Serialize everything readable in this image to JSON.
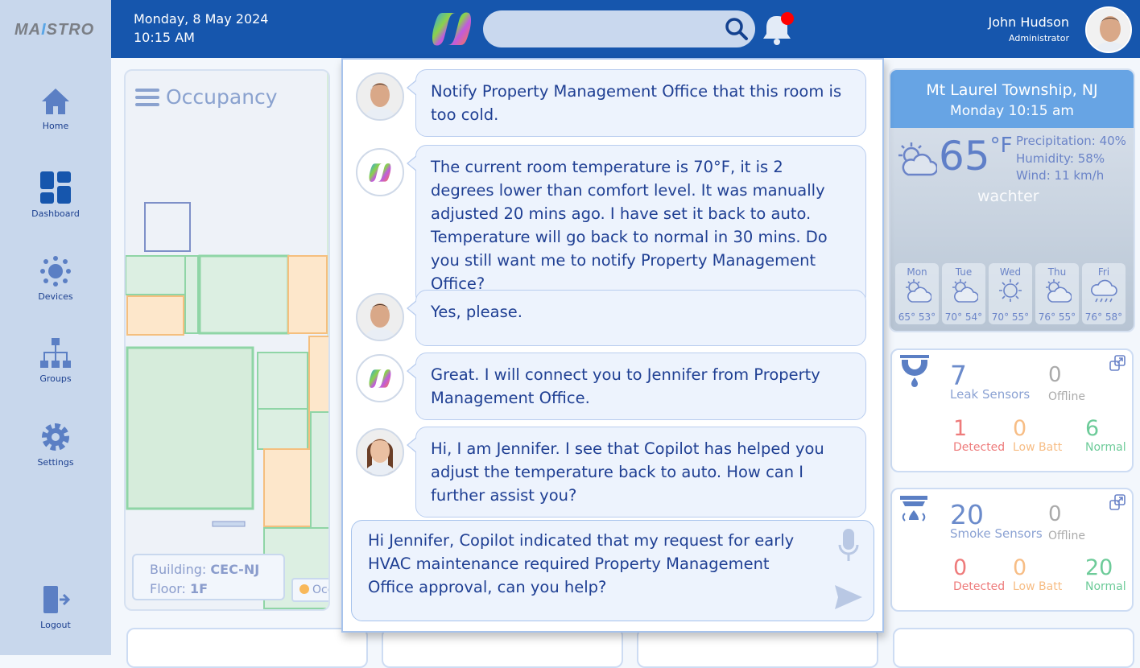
{
  "sidebar": {
    "logo": "MAISTRO",
    "items": [
      {
        "label": "Home",
        "icon": "home-icon"
      },
      {
        "label": "Dashboard",
        "icon": "dashboard-icon"
      },
      {
        "label": "Devices",
        "icon": "devices-icon"
      },
      {
        "label": "Groups",
        "icon": "groups-icon"
      },
      {
        "label": "Settings",
        "icon": "gear-icon"
      }
    ],
    "logout": "Logout"
  },
  "header": {
    "date": "Monday, 8 May 2024",
    "time": "10:15 AM",
    "search_placeholder": "",
    "user_name": "John Hudson",
    "user_role": "Administrator",
    "notification_dot_color": "#ff0000"
  },
  "occupancy": {
    "title": "Occupancy",
    "building_label": "Building:",
    "building": "CEC-NJ",
    "floor_label": "Floor:",
    "floor": "1F",
    "legend": "Occup"
  },
  "chat": {
    "messages": [
      {
        "sender": "user",
        "text": "Notify Property Management Office that this room is too cold."
      },
      {
        "sender": "copilot",
        "text": "The current room temperature is 70°F, it is 2 degrees lower than comfort level. It was manually adjusted 20 mins ago. I have set it back to auto. Temperature will go back to normal in 30 mins. Do you still want me to notify Property Management Office?"
      },
      {
        "sender": "user",
        "text": "Yes, please."
      },
      {
        "sender": "copilot",
        "text": "Great. I will connect you to Jennifer from Property Management Office."
      },
      {
        "sender": "jennifer",
        "text": "Hi, I am Jennifer. I see that Copilot has helped you adjust the temperature back to auto. How can I further assist you?"
      }
    ],
    "input_value": "Hi Jennifer, Copilot indicated that my request for early HVAC maintenance required Property Management Office approval, can you help?"
  },
  "weather": {
    "location": "Mt Laurel Township, NJ",
    "datetime": "Monday 10:15 am",
    "temp": "65",
    "unit": "°F",
    "precipitation": "Precipitation: 40%",
    "humidity": "Humidity: 58%",
    "wind": "Wind: 11 km/h",
    "brand": "wachter",
    "forecast": [
      {
        "day": "Mon",
        "hi": "65°",
        "lo": "53°",
        "icon": "partly-cloudy"
      },
      {
        "day": "Tue",
        "hi": "70°",
        "lo": "54°",
        "icon": "partly-cloudy"
      },
      {
        "day": "Wed",
        "hi": "70°",
        "lo": "55°",
        "icon": "sunny"
      },
      {
        "day": "Thu",
        "hi": "76°",
        "lo": "55°",
        "icon": "partly-cloudy"
      },
      {
        "day": "Fri",
        "hi": "76°",
        "lo": "58°",
        "icon": "rain"
      }
    ]
  },
  "leak": {
    "count": "7",
    "label": "Leak Sensors",
    "offline": "0",
    "offline_label": "Offline",
    "detected": "1",
    "detected_label": "Detected",
    "lowbatt": "0",
    "lowbatt_label": "Low Batt",
    "normal": "6",
    "normal_label": "Normal"
  },
  "smoke": {
    "count": "20",
    "label": "Smoke Sensors",
    "offline": "0",
    "offline_label": "Offline",
    "detected": "0",
    "detected_label": "Detected",
    "lowbatt": "0",
    "lowbatt_label": "Low Batt",
    "normal": "20",
    "normal_label": "Normal"
  }
}
